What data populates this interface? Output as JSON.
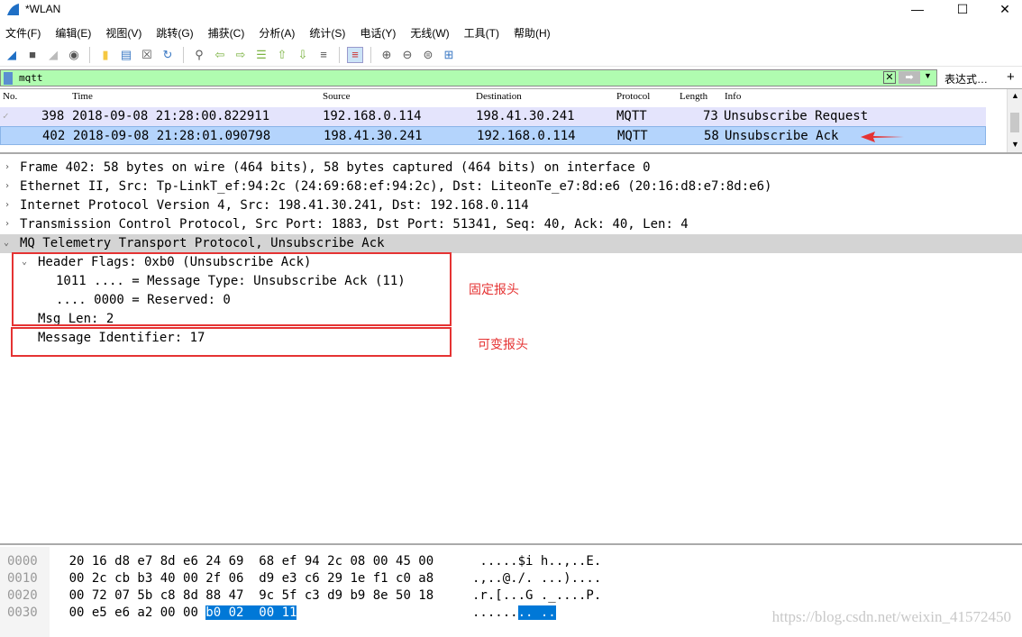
{
  "window": {
    "title": "*WLAN",
    "controls": [
      "—",
      "☐",
      "✕"
    ]
  },
  "menu": [
    "文件(F)",
    "编辑(E)",
    "视图(V)",
    "跳转(G)",
    "捕获(C)",
    "分析(A)",
    "统计(S)",
    "电话(Y)",
    "无线(W)",
    "工具(T)",
    "帮助(H)"
  ],
  "toolbar_icons": [
    "shark-fin-start-icon",
    "stop-icon",
    "restart-icon",
    "options-icon",
    "open-file-icon",
    "save-file-icon",
    "close-file-icon",
    "reload-icon",
    "find-icon",
    "back-icon",
    "forward-icon",
    "goto-packet-icon",
    "first-packet-icon",
    "last-packet-icon",
    "autoscroll-icon",
    "colorize-icon",
    "zoom-in-icon",
    "zoom-out-icon",
    "zoom-normal-icon",
    "resize-columns-icon"
  ],
  "filter": {
    "value": "mqtt",
    "expression_label": "表达式…",
    "plus": "+"
  },
  "packet_list": {
    "columns": [
      "No.",
      "Time",
      "Source",
      "Destination",
      "Protocol",
      "Length",
      "Info"
    ],
    "rows": [
      {
        "no": "398",
        "time": "2018-09-08 21:28:00.822911",
        "source": "192.168.0.114",
        "destination": "198.41.30.241",
        "protocol": "MQTT",
        "length": "73",
        "info": "Unsubscribe Request"
      },
      {
        "no": "402",
        "time": "2018-09-08 21:28:01.090798",
        "source": "198.41.30.241",
        "destination": "192.168.0.114",
        "protocol": "MQTT",
        "length": "58",
        "info": "Unsubscribe Ack",
        "selected": true
      }
    ]
  },
  "details": [
    "Frame 402: 58 bytes on wire (464 bits), 58 bytes captured (464 bits) on interface 0",
    "Ethernet II, Src: Tp-LinkT_ef:94:2c (24:69:68:ef:94:2c), Dst: LiteonTe_e7:8d:e6 (20:16:d8:e7:8d:e6)",
    "Internet Protocol Version 4, Src: 198.41.30.241, Dst: 192.168.0.114",
    "Transmission Control Protocol, Src Port: 1883, Dst Port: 51341, Seq: 40, Ack: 40, Len: 4",
    "MQ Telemetry Transport Protocol, Unsubscribe Ack",
    "Header Flags: 0xb0 (Unsubscribe Ack)",
    "1011 .... = Message Type: Unsubscribe Ack (11)",
    ".... 0000 = Reserved: 0",
    "Msg Len: 2",
    "Message Identifier: 17"
  ],
  "annotations": {
    "fixed_header": "固定报头",
    "variable_header": "可变报头"
  },
  "hex": [
    {
      "offset": "0000",
      "bytes": "20 16 d8 e7 8d e6 24 69  68 ef 94 2c 08 00 45 00",
      "sel": "",
      "ascii": " .....$i h..,..E.",
      "asel": ""
    },
    {
      "offset": "0010",
      "bytes": "00 2c cb b3 40 00 2f 06  d9 e3 c6 29 1e f1 c0 a8",
      "sel": "",
      "ascii": ".,..@./. ...)....",
      "asel": ""
    },
    {
      "offset": "0020",
      "bytes": "00 72 07 5b c8 8d 88 47  9c 5f c3 d9 b9 8e 50 18",
      "sel": "",
      "ascii": ".r.[...G ._....P.",
      "asel": ""
    },
    {
      "offset": "0030",
      "bytes": "00 e5 e6 a2 00 00 ",
      "sel": "b0 02  00 11",
      "ascii": "......",
      "asel": ".. .."
    }
  ],
  "watermark": "https://blog.csdn.net/weixin_41572450",
  "colors": {
    "filter_ok": "#b0fcb0",
    "row_selected": "#b4d4fc",
    "row_mqtt": "#e4e4fc",
    "hex_selected": "#0078d7",
    "annotation": "#e53333"
  }
}
